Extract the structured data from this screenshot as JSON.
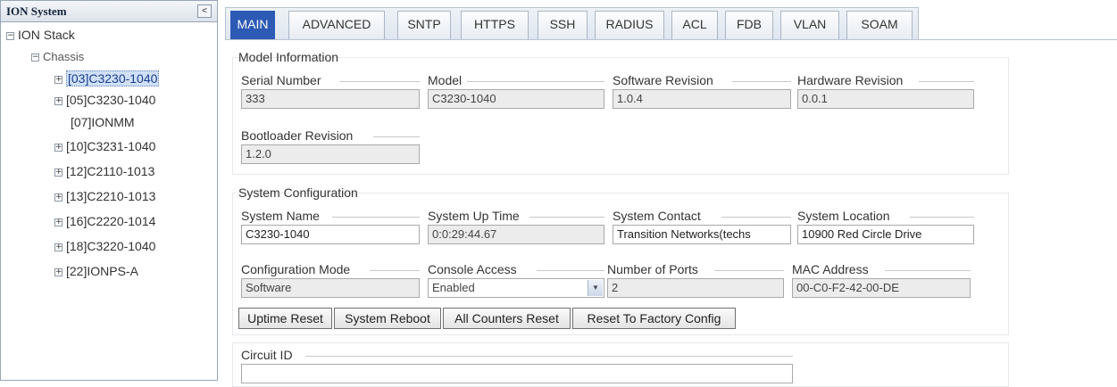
{
  "tree": {
    "title": "ION System",
    "collapse_label": "<",
    "root": "ION Stack",
    "chassis": "Chassis",
    "nodes": [
      "[03]C3230-1040",
      "[05]C3230-1040",
      "[07]IONMM",
      "[10]C3231-1040",
      "[12]C2110-1013",
      "[13]C2210-1013",
      "[16]C2220-1014",
      "[18]C3220-1040",
      "[22]IONPS-A"
    ],
    "expander_symbol": "+",
    "collapse_symbol": "−"
  },
  "tabs": [
    "MAIN",
    "ADVANCED",
    "SNTP",
    "HTTPS",
    "SSH",
    "RADIUS",
    "ACL",
    "FDB",
    "VLAN",
    "SOAM"
  ],
  "model_info": {
    "title": "Model Information",
    "serial_number": {
      "label": "Serial Number",
      "value": "333"
    },
    "model": {
      "label": "Model",
      "value": "C3230-1040"
    },
    "software_revision": {
      "label": "Software Revision",
      "value": "1.0.4"
    },
    "hardware_revision": {
      "label": "Hardware Revision",
      "value": "0.0.1"
    },
    "bootloader_revision": {
      "label": "Bootloader Revision",
      "value": "1.2.0"
    }
  },
  "system_config": {
    "title": "System Configuration",
    "system_name": {
      "label": "System Name",
      "value": "C3230-1040"
    },
    "system_up_time": {
      "label": "System Up Time",
      "value": "0:0:29:44.67"
    },
    "system_contact": {
      "label": "System Contact",
      "value": "Transition Networks(techs"
    },
    "system_location": {
      "label": "System Location",
      "value": "10900 Red Circle Drive"
    },
    "configuration_mode": {
      "label": "Configuration Mode",
      "value": "Software"
    },
    "console_access": {
      "label": "Console Access",
      "value": "Enabled"
    },
    "number_of_ports": {
      "label": "Number of Ports",
      "value": "2"
    },
    "mac_address": {
      "label": "MAC Address",
      "value": "00-C0-F2-42-00-DE"
    }
  },
  "buttons": {
    "uptime_reset": "Uptime Reset",
    "system_reboot": "System Reboot",
    "all_counters_reset": "All Counters Reset",
    "reset_factory": "Reset To Factory Config"
  },
  "circuit": {
    "label": "Circuit ID",
    "value": ""
  },
  "colors": {
    "active_tab": "#2c5ab5",
    "selected_node": "#cfe0f7"
  }
}
